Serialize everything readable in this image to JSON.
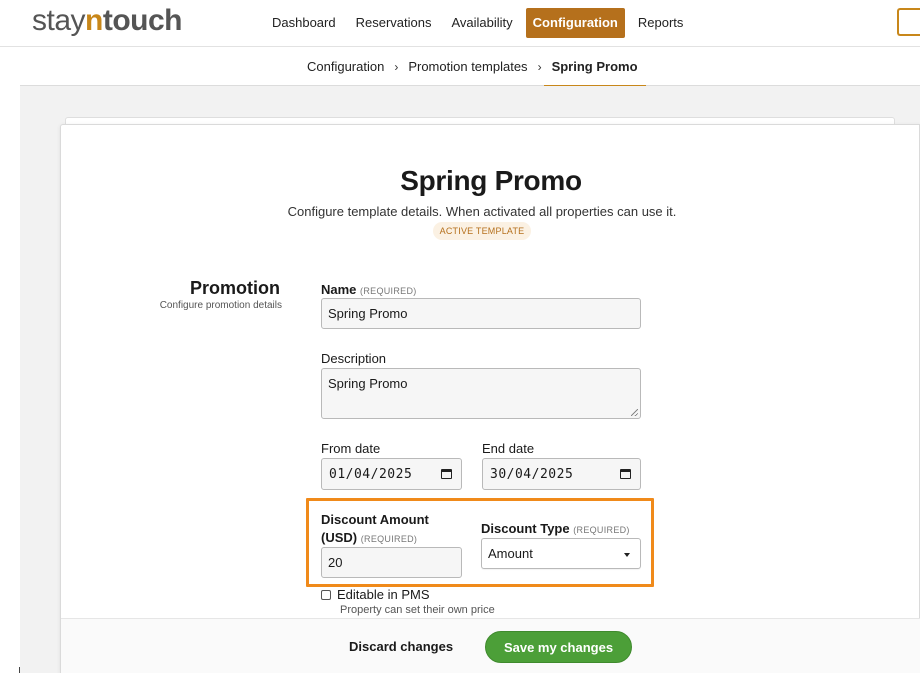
{
  "brand": {
    "stay": "stay",
    "n": "n",
    "touch": "touch"
  },
  "nav": {
    "items": [
      {
        "label": "Dashboard",
        "active": false
      },
      {
        "label": "Reservations",
        "active": false
      },
      {
        "label": "Availability",
        "active": false
      },
      {
        "label": "Configuration",
        "active": true
      },
      {
        "label": "Reports",
        "active": false
      }
    ]
  },
  "breadcrumb": {
    "items": [
      "Configuration",
      "Promotion templates"
    ],
    "separator": "›",
    "current": "Spring Promo"
  },
  "header": {
    "title": "Spring Promo",
    "subtitle": "Configure template details. When activated all properties can use it.",
    "badge": "ACTIVE TEMPLATE"
  },
  "section": {
    "title": "Promotion",
    "description": "Configure promotion details"
  },
  "form": {
    "name": {
      "label": "Name",
      "required": "(REQUIRED)",
      "value": "Spring Promo"
    },
    "description": {
      "label": "Description",
      "value": "Spring Promo"
    },
    "from_date": {
      "label": "From date",
      "value": "01/04/2025"
    },
    "end_date": {
      "label": "End date",
      "value": "30/04/2025"
    },
    "discount_amount": {
      "label_line1": "Discount Amount",
      "label_line2": "(USD)",
      "required": "(REQUIRED)",
      "value": "20"
    },
    "discount_type": {
      "label": "Discount Type",
      "required": "(REQUIRED)",
      "value": "Amount"
    },
    "editable": {
      "label": "Editable in PMS",
      "help": "Property can set their own price",
      "checked": false
    }
  },
  "footer": {
    "discard_label": "Discard changes",
    "save_label": "Save my changes"
  },
  "colors": {
    "brand_accent": "#c8871a",
    "nav_active": "#b5701c",
    "highlight": "#f08a1a",
    "save_button": "#4c9f38"
  }
}
